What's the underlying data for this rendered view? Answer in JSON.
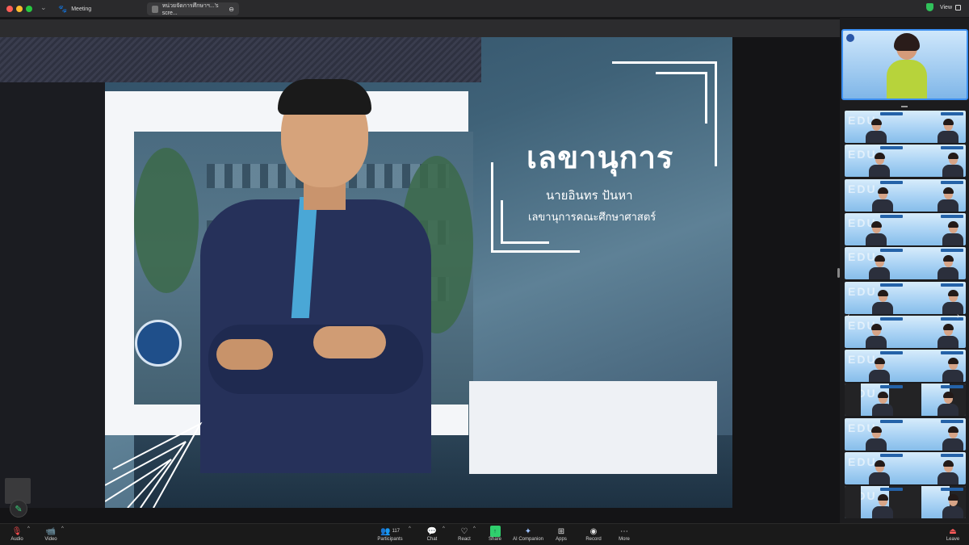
{
  "titlebar": {
    "meeting_label": "Meeting",
    "share_tab_label": "หน่วยจัดการศึกษาฯ...'s scre...",
    "view_label": "View"
  },
  "slide": {
    "heading": "เลขานุการ",
    "name": "นายอินทร  ปันหา",
    "role": "เลขานุการคณะศึกษาศาสตร์"
  },
  "gallery": {
    "rows": 12,
    "watermark": "EDU"
  },
  "toolbar": {
    "audio": "Audio",
    "video": "Video",
    "participants": "Participants",
    "participants_count": "117",
    "chat": "Chat",
    "react": "React",
    "share": "Share",
    "ai_companion": "AI Companion",
    "apps": "Apps",
    "record": "Record",
    "more": "More",
    "leave": "Leave"
  },
  "colors": {
    "accent_blue": "#3b8ef0",
    "share_green": "#2fcf6d",
    "mic_red": "#ff4d4f"
  }
}
